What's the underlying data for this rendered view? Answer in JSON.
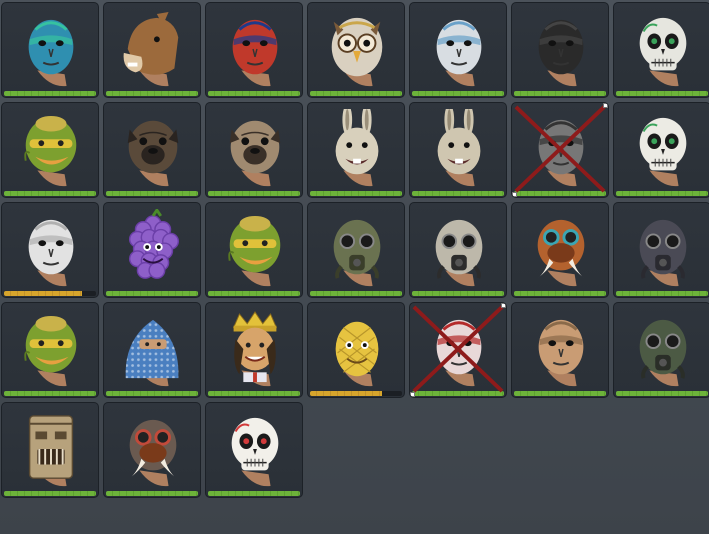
{
  "inventory": {
    "slots": [
      {
        "name": "blue-tribal-mask",
        "kind": "face",
        "paint": "#2f8fb0",
        "accent": "#36c2a0",
        "progress": 1.0,
        "bar": "green"
      },
      {
        "name": "horse-mask",
        "kind": "horse",
        "paint": "#9c6a3c",
        "accent": "#e0c9a8",
        "progress": 1.0,
        "bar": "green"
      },
      {
        "name": "flag-paint-mask",
        "kind": "face",
        "paint": "#c0392b",
        "accent": "#1e3a8a",
        "progress": 1.0,
        "bar": "green"
      },
      {
        "name": "owl-mask",
        "kind": "owl",
        "paint": "#d9d0c0",
        "accent": "#e3a93a",
        "progress": 1.0,
        "bar": "green"
      },
      {
        "name": "white-ape-mask",
        "kind": "face",
        "paint": "#d8dde2",
        "accent": "#6aa1c9",
        "progress": 1.0,
        "bar": "green"
      },
      {
        "name": "black-face-mask",
        "kind": "face",
        "paint": "#2a2a2a",
        "accent": "#444",
        "progress": 1.0,
        "bar": "green"
      },
      {
        "name": "skull-mask",
        "kind": "skull",
        "paint": "#e6e6df",
        "accent": "#3aa35a",
        "progress": 1.0,
        "bar": "green"
      },
      {
        "name": "green-lizard-mask",
        "kind": "lizard",
        "paint": "#7da02f",
        "accent": "#e0c13a",
        "progress": 1.0,
        "bar": "green"
      },
      {
        "name": "pug-mask-dark",
        "kind": "pug",
        "paint": "#5a4a3a",
        "accent": "#2a2420",
        "progress": 1.0,
        "bar": "green"
      },
      {
        "name": "pug-mask-light",
        "kind": "pug",
        "paint": "#a08a70",
        "accent": "#3a3028",
        "progress": 1.0,
        "bar": "green"
      },
      {
        "name": "bunny-mask",
        "kind": "bunny",
        "paint": "#d8d0bc",
        "accent": "#9a8f7a",
        "progress": 1.0,
        "bar": "green"
      },
      {
        "name": "bunny-mask-2",
        "kind": "bunny",
        "paint": "#cfc6b0",
        "accent": "#958a74",
        "progress": 1.0,
        "bar": "green"
      },
      {
        "name": "crossed-out-mask",
        "kind": "face",
        "paint": "#777",
        "accent": "#333",
        "progress": 1.0,
        "bar": "green",
        "crossed": true
      },
      {
        "name": "skull-mask-2",
        "kind": "skull",
        "paint": "#ecebe4",
        "accent": "#3aa35a",
        "progress": 1.0,
        "bar": "green"
      },
      {
        "name": "yeti-mask",
        "kind": "face",
        "paint": "#e2e2e2",
        "accent": "#b0b0b0",
        "progress": 0.85,
        "bar": "yellow"
      },
      {
        "name": "grape-mask",
        "kind": "grape",
        "paint": "#8e5fc9",
        "accent": "#6b3fa8",
        "progress": 1.0,
        "bar": "green"
      },
      {
        "name": "green-lizard-mask-2",
        "kind": "lizard",
        "paint": "#7da02f",
        "accent": "#e0c13a",
        "progress": 1.0,
        "bar": "green"
      },
      {
        "name": "gas-mask",
        "kind": "gas",
        "paint": "#6a7250",
        "accent": "#3a3e2a",
        "progress": 1.0,
        "bar": "green"
      },
      {
        "name": "skull-gas-mask",
        "kind": "gas",
        "paint": "#bdb8aa",
        "accent": "#2c2c2c",
        "progress": 1.0,
        "bar": "green"
      },
      {
        "name": "walrus-mask",
        "kind": "walrus",
        "paint": "#b4622e",
        "accent": "#3ba6b3",
        "progress": 1.0,
        "bar": "green"
      },
      {
        "name": "dark-gas-mask",
        "kind": "gas",
        "paint": "#4a4a55",
        "accent": "#2a2a30",
        "progress": 1.0,
        "bar": "green"
      },
      {
        "name": "green-lizard-mask-3",
        "kind": "lizard",
        "paint": "#7da02f",
        "accent": "#e0c13a",
        "progress": 1.0,
        "bar": "green"
      },
      {
        "name": "bandana-mask",
        "kind": "bandana",
        "paint": "#4a7fc0",
        "accent": "#dfe9f5",
        "progress": 1.0,
        "bar": "green"
      },
      {
        "name": "king-mask",
        "kind": "king",
        "paint": "#d7a46a",
        "accent": "#e3c23a",
        "progress": 1.0,
        "bar": "green"
      },
      {
        "name": "pineapple-mask",
        "kind": "pineapple",
        "paint": "#e6c340",
        "accent": "#b8962a",
        "progress": 0.78,
        "bar": "yellow"
      },
      {
        "name": "crossed-out-demon-mask",
        "kind": "face",
        "paint": "#e8d8d8",
        "accent": "#b42a2a",
        "progress": 1.0,
        "bar": "green",
        "crossed": true
      },
      {
        "name": "aviator-mask",
        "kind": "face",
        "paint": "#c99c74",
        "accent": "#8a6a4a",
        "progress": 1.0,
        "bar": "green"
      },
      {
        "name": "dark-gas-mask-2",
        "kind": "gas",
        "paint": "#4c5a44",
        "accent": "#2a2e28",
        "progress": 1.0,
        "bar": "green"
      },
      {
        "name": "tiki-mask",
        "kind": "tiki",
        "paint": "#b7a27c",
        "accent": "#5a4a32",
        "progress": 1.0,
        "bar": "green"
      },
      {
        "name": "tusk-gas-mask",
        "kind": "walrus",
        "paint": "#6a5a50",
        "accent": "#c24a3a",
        "progress": 1.0,
        "bar": "green"
      },
      {
        "name": "sugar-skull-mask",
        "kind": "skull",
        "paint": "#f2f0ea",
        "accent": "#d23a3a",
        "progress": 1.0,
        "bar": "green"
      }
    ]
  }
}
